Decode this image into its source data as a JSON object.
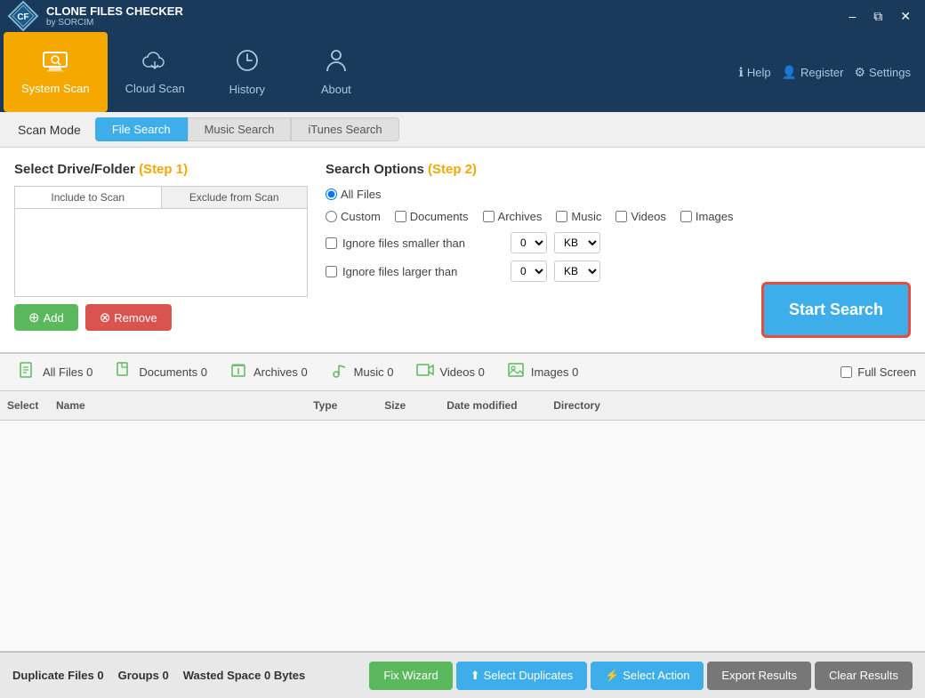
{
  "app": {
    "title": "CLONE FILES CHECKER",
    "subtitle": "by SORCIM",
    "title_bar": {
      "minimize": "–",
      "maximize": "⧉",
      "close": "✕"
    }
  },
  "nav": {
    "items": [
      {
        "id": "system-scan",
        "label": "System Scan",
        "icon": "🖥",
        "active": true
      },
      {
        "id": "cloud-scan",
        "label": "Cloud Scan",
        "icon": "☁"
      },
      {
        "id": "history",
        "label": "History",
        "icon": "🕐"
      },
      {
        "id": "about",
        "label": "About",
        "icon": "👤"
      }
    ],
    "help": "Help",
    "register": "Register",
    "settings": "Settings"
  },
  "scan_mode": {
    "label": "Scan Mode",
    "tabs": [
      {
        "id": "file-search",
        "label": "File Search",
        "active": true
      },
      {
        "id": "music-search",
        "label": "Music Search"
      },
      {
        "id": "itunes-search",
        "label": "iTunes Search"
      }
    ]
  },
  "left_panel": {
    "title": "Select Drive/Folder",
    "step": "(Step 1)",
    "include_tab": "Include to Scan",
    "exclude_tab": "Exclude from Scan",
    "add_btn": "Add",
    "remove_btn": "Remove"
  },
  "right_panel": {
    "title": "Search Options",
    "step": "(Step 2)",
    "file_types": [
      {
        "id": "all-files",
        "label": "All Files",
        "type": "radio",
        "checked": true
      },
      {
        "id": "custom",
        "label": "Custom",
        "type": "radio"
      },
      {
        "id": "documents",
        "label": "Documents",
        "type": "checkbox"
      },
      {
        "id": "archives",
        "label": "Archives",
        "type": "checkbox"
      },
      {
        "id": "music",
        "label": "Music",
        "type": "checkbox"
      },
      {
        "id": "videos",
        "label": "Videos",
        "type": "checkbox"
      },
      {
        "id": "images",
        "label": "Images",
        "type": "checkbox"
      }
    ],
    "ignore_smaller": "Ignore files smaller than",
    "ignore_larger": "Ignore files larger than",
    "size_value_1": "0",
    "size_unit_1": "KB",
    "size_value_2": "0",
    "size_unit_2": "KB",
    "start_search": "Start Search"
  },
  "results_tabs": [
    {
      "id": "all-files",
      "label": "All Files",
      "count": "0",
      "icon": "📋"
    },
    {
      "id": "documents",
      "label": "Documents",
      "count": "0",
      "icon": "📄"
    },
    {
      "id": "archives",
      "label": "Archives",
      "count": "0",
      "icon": "📦"
    },
    {
      "id": "music",
      "label": "Music",
      "count": "0",
      "icon": "🎵"
    },
    {
      "id": "videos",
      "label": "Videos",
      "count": "0",
      "icon": "🎬"
    },
    {
      "id": "images",
      "label": "Images",
      "count": "0",
      "icon": "🖼"
    }
  ],
  "full_screen": "Full Screen",
  "table": {
    "columns": [
      {
        "id": "select",
        "label": "Select"
      },
      {
        "id": "name",
        "label": "Name"
      },
      {
        "id": "type",
        "label": "Type"
      },
      {
        "id": "size",
        "label": "Size"
      },
      {
        "id": "date",
        "label": "Date modified"
      },
      {
        "id": "directory",
        "label": "Directory"
      }
    ]
  },
  "bottom_bar": {
    "duplicate_files_label": "Duplicate Files",
    "duplicate_files_count": "0",
    "groups_label": "Groups",
    "groups_count": "0",
    "wasted_space_label": "Wasted Space",
    "wasted_space_value": "0 Bytes",
    "fix_wizard": "Fix Wizard",
    "select_duplicates": "Select Duplicates",
    "select_action": "Select Action",
    "export_results": "Export Results",
    "clear_results": "Clear Results"
  }
}
